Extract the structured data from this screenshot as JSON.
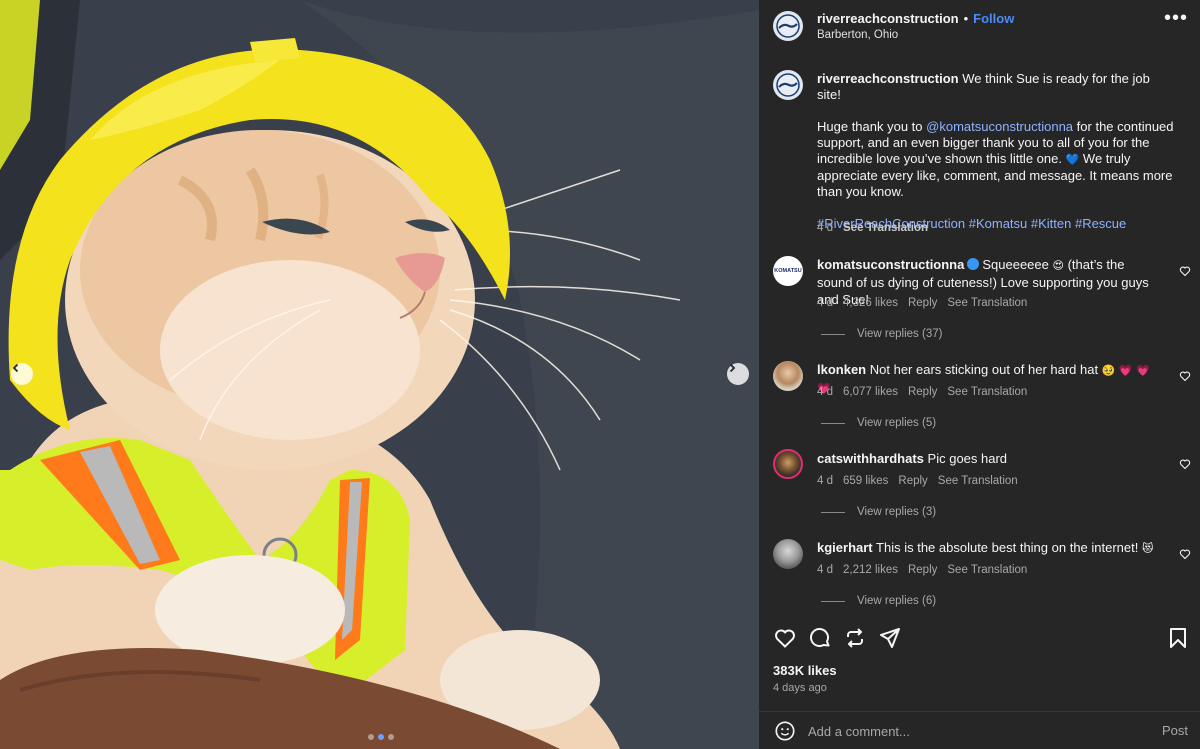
{
  "post": {
    "username": "riverreachconstruction",
    "follow_label": "Follow",
    "location": "Barberton, Ohio",
    "more_label": "•••"
  },
  "caption": {
    "username": "riverreachconstruction",
    "line1": "We think Sue is ready for the job site!",
    "para2_pre": "Huge thank you to",
    "para2_mention": "@komatsuconstructionna",
    "para2_post": "for the continued support, and an even bigger thank you to all of you for the incredible love you’ve shown this little one.",
    "para2_emoji": "💙",
    "para2_end": "We truly appreciate every like, comment, and message. It means more than you know.",
    "hashtags": "#RiverReachConstruction #Komatsu #Kitten #Rescue",
    "time": "4 d",
    "see_translation": "See Translation"
  },
  "comments": [
    {
      "username": "komatsuconstructionna",
      "verified": true,
      "text_pre": "Squeeeeee",
      "emoji": "😍",
      "text_post": "(that’s the sound of us dying of cuteness!) Love supporting you guys and Sue!",
      "time": "4 d",
      "likes": "4,326 likes",
      "reply": "Reply",
      "see_translation": "See Translation",
      "view_replies": "View replies (37)",
      "avatar_text": "KOMATSU"
    },
    {
      "username": "lkonken",
      "text_pre": "Not her ears sticking out of her hard hat",
      "emoji": "🥹 💗 💗 💗",
      "text_post": "",
      "time": "4 d",
      "likes": "6,077 likes",
      "reply": "Reply",
      "see_translation": "See Translation",
      "view_replies": "View replies (5)"
    },
    {
      "username": "catswithhardhats",
      "text_pre": "Pic goes hard",
      "emoji": "",
      "text_post": "",
      "time": "4 d",
      "likes": "659 likes",
      "reply": "Reply",
      "see_translation": "See Translation",
      "view_replies": "View replies (3)"
    },
    {
      "username": "kgierhart",
      "text_pre": "This is the absolute best thing on the internet!",
      "emoji": "😻",
      "text_post": "",
      "time": "4 d",
      "likes": "2,212 likes",
      "reply": "Reply",
      "see_translation": "See Translation",
      "view_replies": "View replies (6)"
    }
  ],
  "footer": {
    "likes": "383K likes",
    "posted": "4 days ago",
    "comment_placeholder": "Add a comment...",
    "post_label": "Post"
  },
  "carousel": {
    "slide_count": 3,
    "active_slide": 2
  },
  "icons": [
    "heart-icon",
    "comment-icon",
    "repost-icon",
    "share-icon",
    "bookmark-icon",
    "emoji-icon",
    "chevron-left-icon",
    "chevron-right-icon",
    "more-icon",
    "verified-icon"
  ],
  "colors": {
    "panel_bg": "#262626",
    "link": "#8fb3ff",
    "follow": "#4c8bf5",
    "muted": "#a8a8a8",
    "hat": "#f4e21c",
    "vest": "#d9f028",
    "stripe": "#ff7a1a"
  }
}
